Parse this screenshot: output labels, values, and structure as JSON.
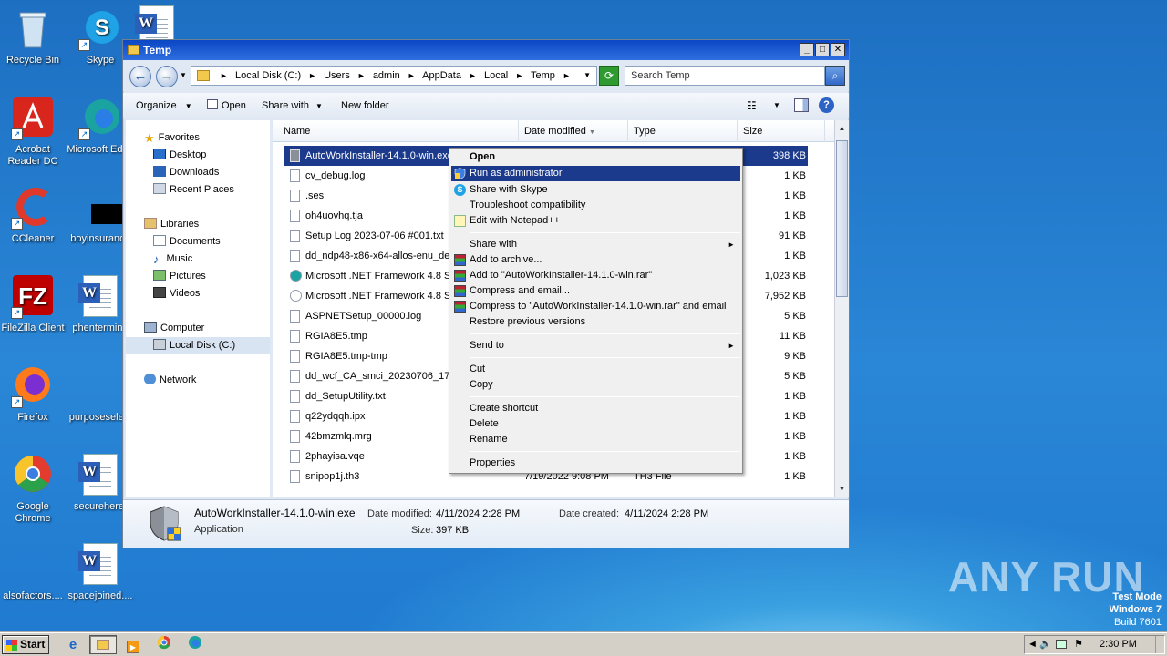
{
  "desktop": {
    "icons": [
      {
        "label": "Recycle Bin",
        "icon": "recycle-bin-icon"
      },
      {
        "label": "Skype",
        "icon": "skype-icon"
      },
      {
        "label": "Acrobat Reader DC",
        "icon": "acrobat-icon"
      },
      {
        "label": "Microsoft Edge",
        "icon": "edge-icon"
      },
      {
        "label": "CCleaner",
        "icon": "ccleaner-icon"
      },
      {
        "label": "boyinsurance",
        "icon": "black-file-icon"
      },
      {
        "label": "FileZilla Client",
        "icon": "filezilla-icon"
      },
      {
        "label": "phentermine",
        "icon": "word-doc-icon"
      },
      {
        "label": "Firefox",
        "icon": "firefox-icon"
      },
      {
        "label": "purposeselect",
        "icon": "blank-file-icon"
      },
      {
        "label": "Google Chrome",
        "icon": "chrome-icon"
      },
      {
        "label": "securehere.",
        "icon": "word-doc-icon"
      },
      {
        "label": "alsofactors....",
        "icon": "blank-file-icon"
      },
      {
        "label": "spacejoined....",
        "icon": "word-doc-icon"
      }
    ],
    "watermark": "ANY RUN",
    "test_mode": [
      "Test Mode",
      "Windows 7",
      "Build 7601"
    ]
  },
  "window": {
    "title": "Temp",
    "address": {
      "breadcrumbs": [
        "Local Disk (C:)",
        "Users",
        "admin",
        "AppData",
        "Local",
        "Temp"
      ]
    },
    "search_placeholder": "Search Temp",
    "toolbar": {
      "organize": "Organize",
      "open": "Open",
      "share_with": "Share with",
      "new_folder": "New folder"
    },
    "nav": {
      "favorites": "Favorites",
      "desktop": "Desktop",
      "downloads": "Downloads",
      "recent": "Recent Places",
      "libraries": "Libraries",
      "documents": "Documents",
      "music": "Music",
      "pictures": "Pictures",
      "videos": "Videos",
      "computer": "Computer",
      "local_disk": "Local Disk (C:)",
      "network": "Network"
    },
    "columns": {
      "name": "Name",
      "date": "Date modified",
      "type": "Type",
      "size": "Size"
    },
    "files": [
      {
        "name": "AutoWorkInstaller-14.1.0-win.exe",
        "date": "",
        "type": "",
        "size": "398 KB"
      },
      {
        "name": "cv_debug.log",
        "date": "",
        "type": "",
        "size": "1 KB"
      },
      {
        "name": ".ses",
        "date": "",
        "type": "",
        "size": "1 KB"
      },
      {
        "name": "oh4uovhq.tja",
        "date": "",
        "type": "",
        "size": "1 KB"
      },
      {
        "name": "Setup Log 2023-07-06 #001.txt",
        "date": "",
        "type": "",
        "size": "91 KB"
      },
      {
        "name": "dd_ndp48-x86-x64-allos-enu_de",
        "date": "",
        "type": "",
        "size": "1 KB"
      },
      {
        "name": "Microsoft .NET Framework 4.8 Se",
        "date": "",
        "type": "",
        "size": "1,023 KB"
      },
      {
        "name": "Microsoft .NET Framework 4.8 Se",
        "date": "",
        "type": "",
        "size": "7,952 KB"
      },
      {
        "name": "ASPNETSetup_00000.log",
        "date": "",
        "type": "",
        "size": "5 KB"
      },
      {
        "name": "RGIA8E5.tmp",
        "date": "",
        "type": "",
        "size": "11 KB"
      },
      {
        "name": "RGIA8E5.tmp-tmp",
        "date": "",
        "type": "",
        "size": "9 KB"
      },
      {
        "name": "dd_wcf_CA_smci_20230706_173",
        "date": "",
        "type": "",
        "size": "5 KB"
      },
      {
        "name": "dd_SetupUtility.txt",
        "date": "",
        "type": "",
        "size": "1 KB"
      },
      {
        "name": "q22ydqqh.ipx",
        "date": "",
        "type": "",
        "size": "1 KB"
      },
      {
        "name": "42bmzmlq.mrg",
        "date": "",
        "type": "",
        "size": "1 KB"
      },
      {
        "name": "2phayisa.vqe",
        "date": "",
        "type": "",
        "size": "1 KB"
      },
      {
        "name": "snipop1j.th3",
        "date": "7/19/2022 9:08 PM",
        "type": "TH3 File",
        "size": "1 KB"
      }
    ],
    "details": {
      "name": "AutoWorkInstaller-14.1.0-win.exe",
      "type": "Application",
      "modified_label": "Date modified:",
      "modified": "4/11/2024 2:28 PM",
      "created_label": "Date created:",
      "created": "4/11/2024 2:28 PM",
      "size_label": "Size:",
      "size": "397 KB"
    }
  },
  "context_menu": {
    "items": [
      {
        "label": "Open",
        "bold": true
      },
      {
        "label": "Run as administrator",
        "highlighted": true
      },
      {
        "label": "Share with Skype"
      },
      {
        "label": "Troubleshoot compatibility"
      },
      {
        "label": "Edit with Notepad++"
      },
      {
        "label": "Share with"
      },
      {
        "label": "Add to archive..."
      },
      {
        "label": "Add to \"AutoWorkInstaller-14.1.0-win.rar\""
      },
      {
        "label": "Compress and email..."
      },
      {
        "label": "Compress to \"AutoWorkInstaller-14.1.0-win.rar\" and email"
      },
      {
        "label": "Restore previous versions"
      },
      {
        "label": "Send to"
      },
      {
        "label": "Cut"
      },
      {
        "label": "Copy"
      },
      {
        "label": "Create shortcut"
      },
      {
        "label": "Delete"
      },
      {
        "label": "Rename"
      },
      {
        "label": "Properties"
      }
    ]
  },
  "taskbar": {
    "start": "Start",
    "clock": "2:30 PM"
  }
}
